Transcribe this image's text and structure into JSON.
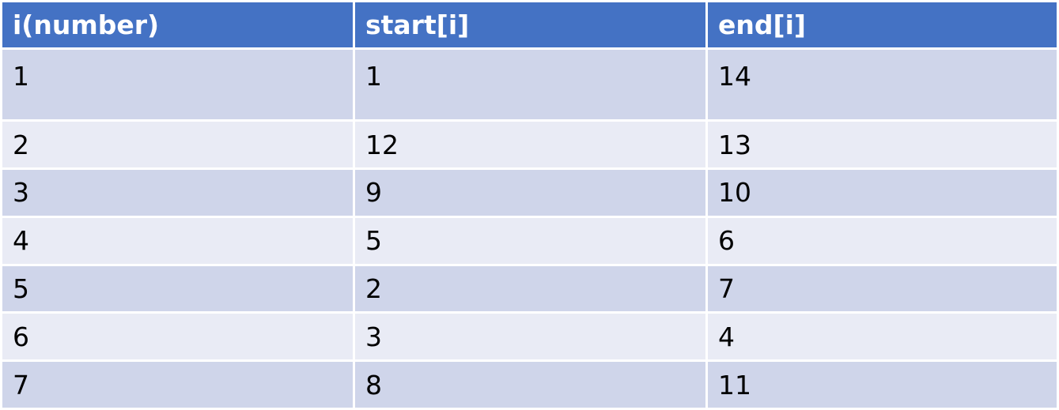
{
  "table": {
    "headers": [
      "i(number)",
      "start[i]",
      "end[i]"
    ],
    "rows": [
      [
        "1",
        "1",
        "14"
      ],
      [
        "2",
        "12",
        "13"
      ],
      [
        "3",
        "9",
        "10"
      ],
      [
        "4",
        "5",
        "6"
      ],
      [
        "5",
        "2",
        "7"
      ],
      [
        "6",
        "3",
        "4"
      ],
      [
        "7",
        "8",
        "11"
      ]
    ]
  },
  "colors": {
    "header_bg": "#4472c4",
    "header_text": "#ffffff",
    "row_odd_bg": "#cfd5ea",
    "row_even_bg": "#e9ebf5"
  }
}
